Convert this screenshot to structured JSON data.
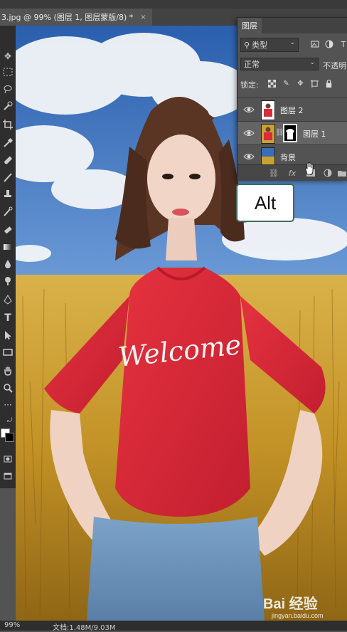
{
  "document_tab": {
    "title": "3.jpg @ 99% (图层 1, 图层蒙版/8) *",
    "close_glyph": "×"
  },
  "toolbar": {
    "tools": [
      "move-tool",
      "marquee-tool",
      "lasso-tool",
      "quick-select-tool",
      "crop-tool",
      "eyedropper-tool",
      "healing-brush-tool",
      "brush-tool",
      "clone-stamp-tool",
      "history-brush-tool",
      "eraser-tool",
      "gradient-tool",
      "blur-tool",
      "dodge-tool",
      "pen-tool",
      "type-tool",
      "path-select-tool",
      "rectangle-tool",
      "hand-tool",
      "zoom-tool",
      "more-tools"
    ]
  },
  "colors": {
    "foreground": "#ffffff",
    "background": "#000000",
    "panel_bg": "#535353",
    "selected_row": "#646464",
    "tooltip_border": "#3d6b5b",
    "shirt": "#d92b3a",
    "sky": "#2e63b0",
    "wheat": "#c9a233"
  },
  "layers_panel": {
    "tab_label": "图层",
    "filter_label": "类型",
    "blend_mode": "正常",
    "opacity_label": "不透明",
    "lock_label": "锁定:",
    "layers": [
      {
        "name": "图层 2",
        "visible": true,
        "selected": false,
        "has_mask": false
      },
      {
        "name": "图层 1",
        "visible": true,
        "selected": true,
        "has_mask": true
      },
      {
        "name": "背景",
        "visible": true,
        "selected": false,
        "has_mask": false
      }
    ],
    "bottom_fx": "fx"
  },
  "tooltip": {
    "text": "Alt"
  },
  "statusbar": {
    "zoom": "99%",
    "doc_size": "文档:1.48M/9.03M"
  },
  "canvas": {
    "shirt_text": "Welcome"
  },
  "watermark": {
    "brand": "Bai 经验",
    "url": "jingyan.baidu.com"
  }
}
